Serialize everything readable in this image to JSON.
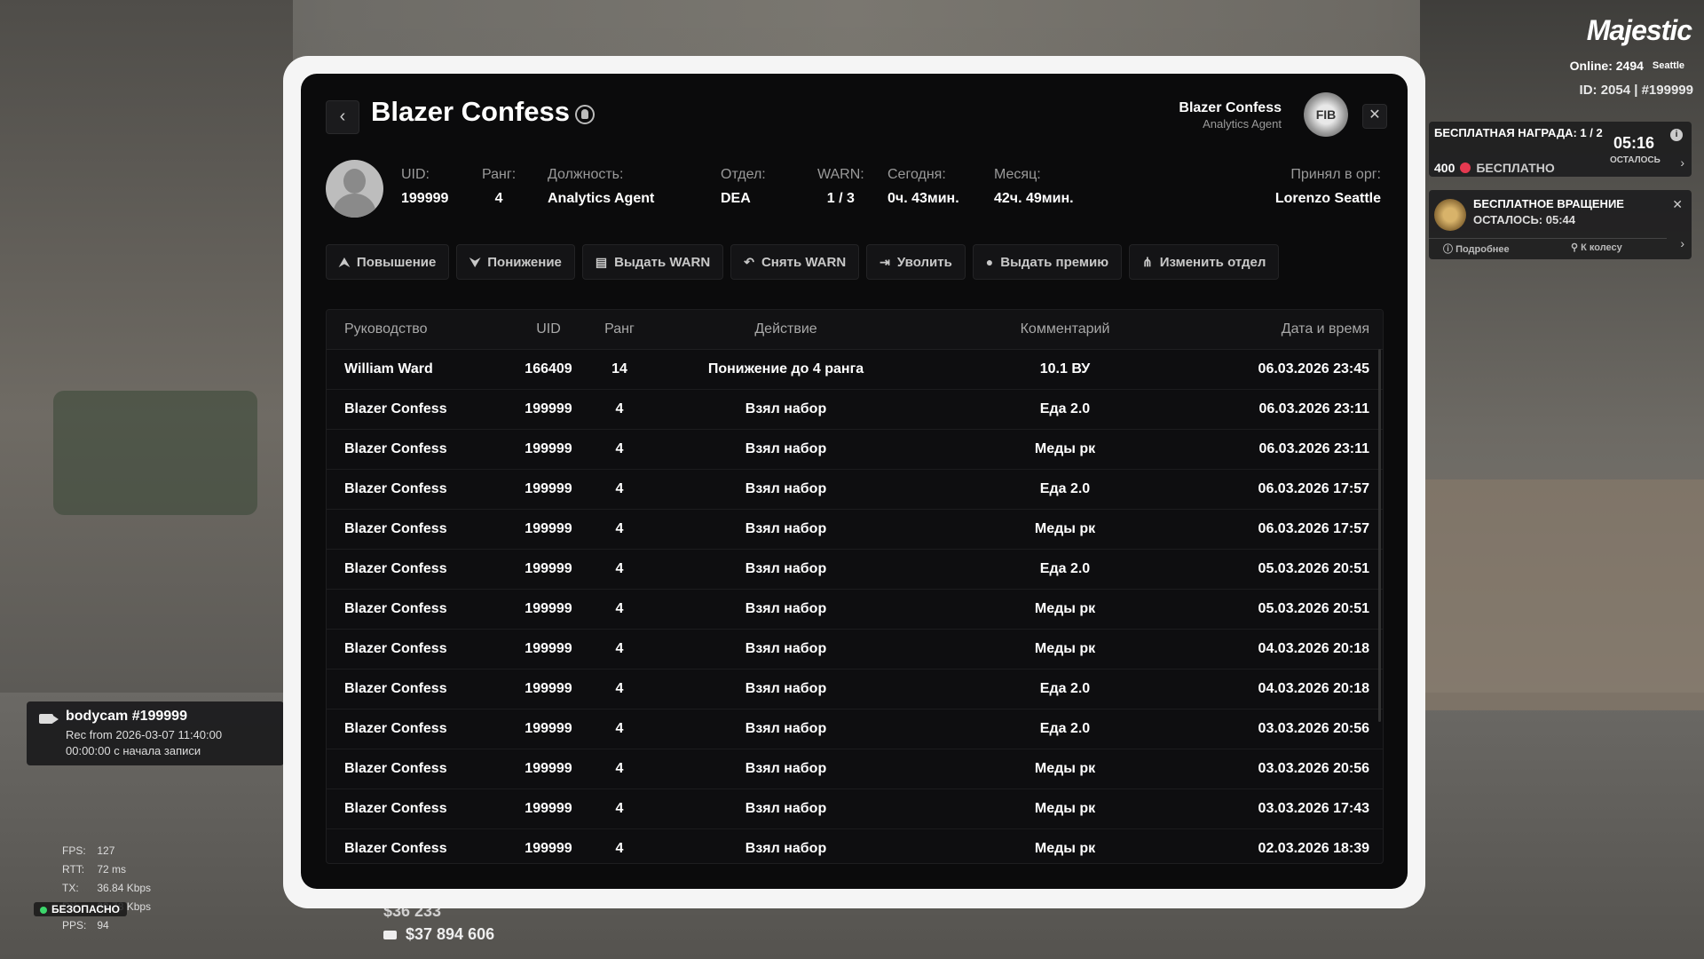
{
  "hud": {
    "logo": "Majestic",
    "online": "Online: 2494",
    "server": "Seattle",
    "id_line": "ID: 2054 | #199999"
  },
  "reward": {
    "title": "БЕСПЛАТНАЯ НАГРАДА: 1 / 2",
    "amount": "400",
    "free": "БЕСПЛАТНО",
    "time": "05:16",
    "left_label": "ОСТАЛОСЬ"
  },
  "spin": {
    "title": "БЕСПЛАТНОЕ ВРАЩЕНИЕ",
    "left": "ОСТАЛОСЬ: 05:44",
    "more": "Подробнее",
    "wheel": "К колесу"
  },
  "bodycam": {
    "title": "bodycam #199999",
    "rec": "Rec from 2026-03-07 11:40:00",
    "elapsed": "00:00:00 с начала записи"
  },
  "stats": {
    "fps": "FPS:",
    "fps_val": "127",
    "rtt": "RTT:",
    "rtt_val": "72 ms",
    "tx": "TX:",
    "tx_val": "36.84 Kbps",
    "rx": "RX:",
    "rx_val": "99.78 Kbps",
    "pps": "PPS:",
    "pps_val": "94",
    "safe": "БЕЗОПАСНО"
  },
  "money": {
    "cash": "$36 233",
    "bank": "$37 894 606"
  },
  "panel": {
    "title": "Blazer Confess",
    "org_name": "Blazer Confess",
    "org_role": "Analytics Agent",
    "seal": "FIB",
    "info": [
      {
        "k": "UID:",
        "v": "199999"
      },
      {
        "k": "Ранг:",
        "v": "4"
      },
      {
        "k": "Должность:",
        "v": "Analytics Agent"
      },
      {
        "k": "Отдел:",
        "v": "DEA"
      },
      {
        "k": "WARN:",
        "v": "1 / 3"
      },
      {
        "k": "Сегодня:",
        "v": "0ч. 43мин."
      },
      {
        "k": "Месяц:",
        "v": "42ч. 49мин."
      },
      {
        "k": "Принял в орг:",
        "v": "Lorenzo Seattle"
      }
    ],
    "actions": [
      "Повышение",
      "Понижение",
      "Выдать WARN",
      "Снять WARN",
      "Уволить",
      "Выдать премию",
      "Изменить отдел"
    ],
    "columns": [
      "Руководство",
      "UID",
      "Ранг",
      "Действие",
      "Комментарий",
      "Дата и время"
    ],
    "rows": [
      [
        "William Ward",
        "166409",
        "14",
        "Понижение до 4 ранга",
        "10.1 ВУ",
        "06.03.2026 23:45"
      ],
      [
        "Blazer Confess",
        "199999",
        "4",
        "Взял набор",
        "Еда 2.0",
        "06.03.2026 23:11"
      ],
      [
        "Blazer Confess",
        "199999",
        "4",
        "Взял набор",
        "Меды рк",
        "06.03.2026 23:11"
      ],
      [
        "Blazer Confess",
        "199999",
        "4",
        "Взял набор",
        "Еда 2.0",
        "06.03.2026 17:57"
      ],
      [
        "Blazer Confess",
        "199999",
        "4",
        "Взял набор",
        "Меды рк",
        "06.03.2026 17:57"
      ],
      [
        "Blazer Confess",
        "199999",
        "4",
        "Взял набор",
        "Еда 2.0",
        "05.03.2026 20:51"
      ],
      [
        "Blazer Confess",
        "199999",
        "4",
        "Взял набор",
        "Меды рк",
        "05.03.2026 20:51"
      ],
      [
        "Blazer Confess",
        "199999",
        "4",
        "Взял набор",
        "Меды рк",
        "04.03.2026 20:18"
      ],
      [
        "Blazer Confess",
        "199999",
        "4",
        "Взял набор",
        "Еда 2.0",
        "04.03.2026 20:18"
      ],
      [
        "Blazer Confess",
        "199999",
        "4",
        "Взял набор",
        "Еда 2.0",
        "03.03.2026 20:56"
      ],
      [
        "Blazer Confess",
        "199999",
        "4",
        "Взял набор",
        "Меды рк",
        "03.03.2026 20:56"
      ],
      [
        "Blazer Confess",
        "199999",
        "4",
        "Взял набор",
        "Меды рк",
        "03.03.2026 17:43"
      ],
      [
        "Blazer Confess",
        "199999",
        "4",
        "Взял набор",
        "Меды рк",
        "02.03.2026 18:39"
      ]
    ]
  }
}
